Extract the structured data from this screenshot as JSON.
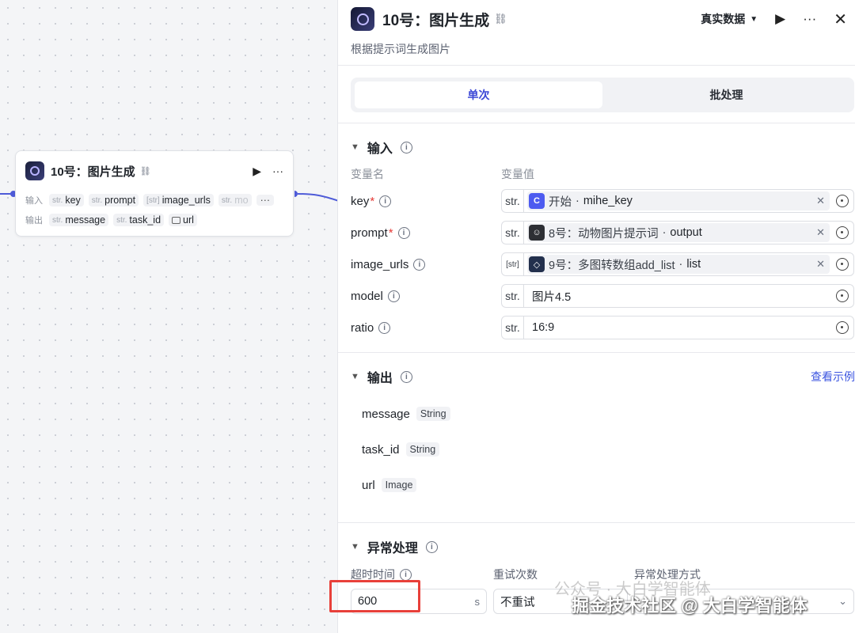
{
  "node": {
    "title": "10号：图片生成",
    "input_label": "输入",
    "output_label": "输出",
    "inputs": [
      {
        "type": "str.",
        "name": "key"
      },
      {
        "type": "str.",
        "name": "prompt"
      },
      {
        "type": "[str]",
        "name": "image_urls"
      },
      {
        "type": "str.",
        "name": "mo"
      }
    ],
    "more": "···",
    "outputs": [
      {
        "type": "str.",
        "name": "message"
      },
      {
        "type": "str.",
        "name": "task_id"
      },
      {
        "type": "image-icon",
        "name": "url"
      }
    ]
  },
  "panel": {
    "title": "10号：图片生成",
    "data_mode": "真实数据",
    "description": "根据提示词生成图片",
    "tabs": [
      "单次",
      "批处理"
    ],
    "input_section": {
      "title": "输入",
      "col_name": "变量名",
      "col_value": "变量值",
      "rows": [
        {
          "name": "key",
          "required": true,
          "type": "str.",
          "src": "开始",
          "var": "mihe_key",
          "icon": "start-node-icon"
        },
        {
          "name": "prompt",
          "required": true,
          "type": "str.",
          "src": "8号：动物图片提示词",
          "var": "output",
          "icon": "robot-icon"
        },
        {
          "name": "image_urls",
          "required": false,
          "type": "[str]",
          "src": "9号：多图转数组add_list",
          "var": "list",
          "icon": "code-node-icon"
        },
        {
          "name": "model",
          "required": false,
          "type": "str.",
          "value": "图片4.5"
        },
        {
          "name": "ratio",
          "required": false,
          "type": "str.",
          "value": "16:9"
        }
      ]
    },
    "output_section": {
      "title": "输出",
      "link": "查看示例",
      "rows": [
        {
          "name": "message",
          "type": "String"
        },
        {
          "name": "task_id",
          "type": "String"
        },
        {
          "name": "url",
          "type": "Image"
        }
      ]
    },
    "error_section": {
      "title": "异常处理",
      "timeout_label": "超时时间",
      "timeout_value": "600",
      "timeout_unit": "s",
      "retry_label": "重试次数",
      "retry_value": "不重试",
      "method_label": "异常处理方式"
    }
  },
  "watermark": {
    "ghost": "公众号 · 大白学智能体",
    "text": "掘金技术社区 @ 大白学智能体"
  },
  "colors": {
    "accent": "#3c48d6",
    "highlight": "#e8403a",
    "required": "#e53935"
  }
}
